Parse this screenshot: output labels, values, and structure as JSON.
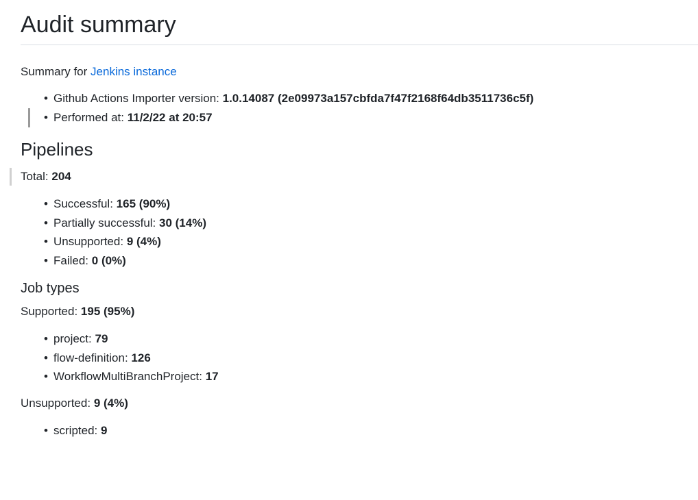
{
  "title": "Audit summary",
  "summary": {
    "prefix": "Summary for",
    "link_text": "Jenkins instance"
  },
  "info": {
    "version_label": "Github Actions Importer version:",
    "version_value": "1.0.14087 (2e09973a157cbfda7f47f2168f64db3511736c5f)",
    "performed_label": "Performed at:",
    "performed_value": "11/2/22 at 20:57"
  },
  "pipelines": {
    "heading": "Pipelines",
    "total_label": "Total:",
    "total_value": "204",
    "items": [
      {
        "label": "Successful:",
        "value": "165 (90%)"
      },
      {
        "label": "Partially successful:",
        "value": "30 (14%)"
      },
      {
        "label": "Unsupported:",
        "value": "9 (4%)"
      },
      {
        "label": "Failed:",
        "value": "0 (0%)"
      }
    ]
  },
  "job_types": {
    "heading": "Job types",
    "supported_label": "Supported:",
    "supported_value": "195 (95%)",
    "supported_items": [
      {
        "label": "project:",
        "value": "79"
      },
      {
        "label": "flow-definition:",
        "value": "126"
      },
      {
        "label": "WorkflowMultiBranchProject:",
        "value": "17"
      }
    ],
    "unsupported_label": "Unsupported:",
    "unsupported_value": "9 (4%)",
    "unsupported_items": [
      {
        "label": "scripted:",
        "value": "9"
      }
    ]
  },
  "colors": {
    "link": "#0969da",
    "text": "#1f2328",
    "rule": "#d8dee4"
  }
}
